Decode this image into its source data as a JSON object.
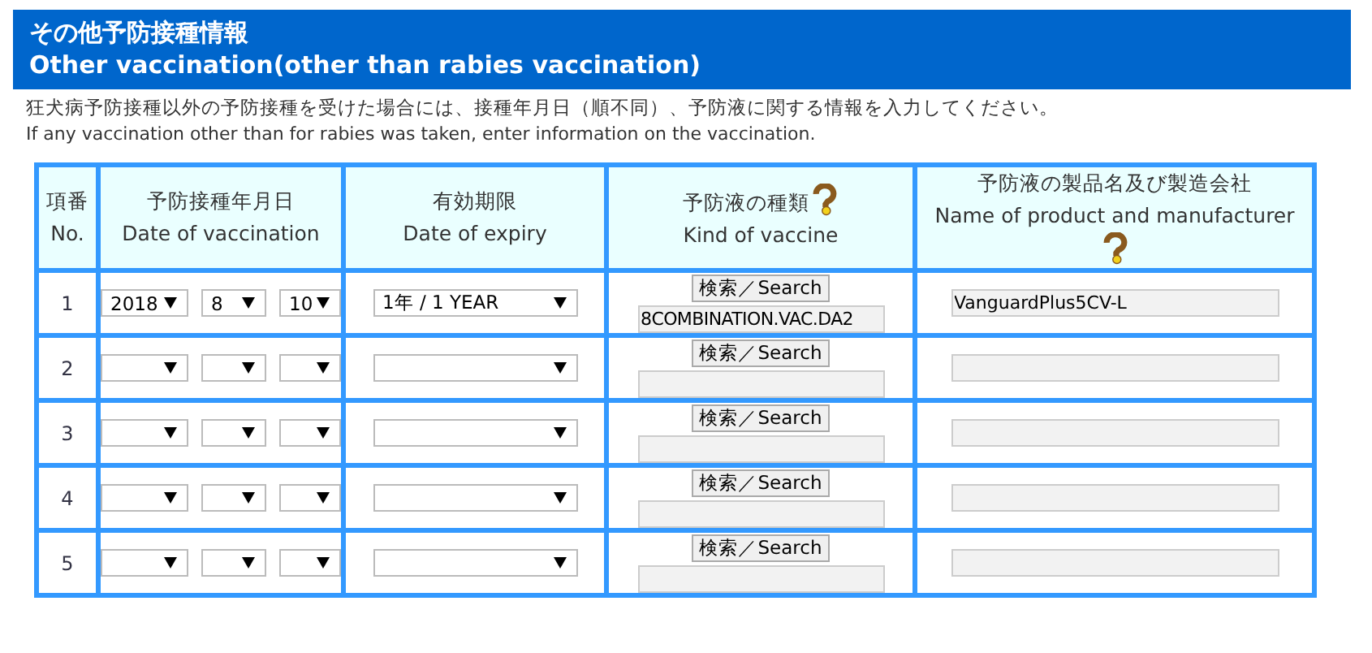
{
  "header": {
    "title_ja": "その他予防接種情報",
    "title_en": "Other vaccination(other than rabies vaccination)"
  },
  "intro": {
    "ja": "狂犬病予防接種以外の予防接種を受けた場合には、接種年月日（順不同）、予防液に関する情報を入力してください。",
    "en": "If any vaccination other than for rabies was taken, enter information on the vaccination."
  },
  "table": {
    "columns": [
      {
        "ja": "項番",
        "en": "No.",
        "help": false
      },
      {
        "ja": "予防接種年月日",
        "en": "Date of vaccination",
        "help": false
      },
      {
        "ja": "有効期限",
        "en": "Date of expiry",
        "help": false
      },
      {
        "ja": "予防液の種類",
        "en": "Kind of vaccine",
        "help": true
      },
      {
        "ja": "予防液の製品名及び製造会社",
        "en": "Name of product and manufacturer",
        "help": true
      }
    ],
    "rows": [
      {
        "no": "1",
        "year": "2018",
        "month": "8",
        "day": "10",
        "expiry": "1年 / 1 YEAR",
        "search_button": "検索／Search",
        "kind": "8COMBINATION.VAC.DA2",
        "product": "VanguardPlus5CV-L"
      },
      {
        "no": "2",
        "search_button": "検索／Search"
      },
      {
        "no": "3",
        "search_button": "検索／Search"
      },
      {
        "no": "4",
        "search_button": "検索／Search"
      },
      {
        "no": "5",
        "search_button": "検索／Search"
      }
    ]
  }
}
